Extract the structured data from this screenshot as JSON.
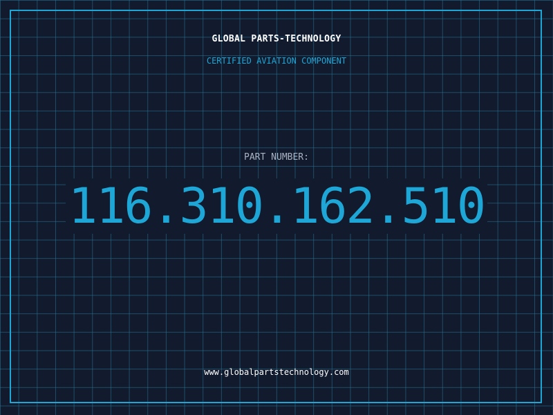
{
  "brand": {
    "company_name": "GLOBAL PARTS-TECHNOLOGY",
    "tagline": "CERTIFIED AVIATION COMPONENT"
  },
  "part": {
    "label": "PART NUMBER:",
    "number": "116.310.162.510"
  },
  "footer": {
    "website": "www.globalpartstechnology.com"
  },
  "colors": {
    "background": "#121a2e",
    "accent": "#1ea7d6",
    "grid": "#287896",
    "text_primary": "#ffffff",
    "text_muted": "#aab3c2"
  }
}
